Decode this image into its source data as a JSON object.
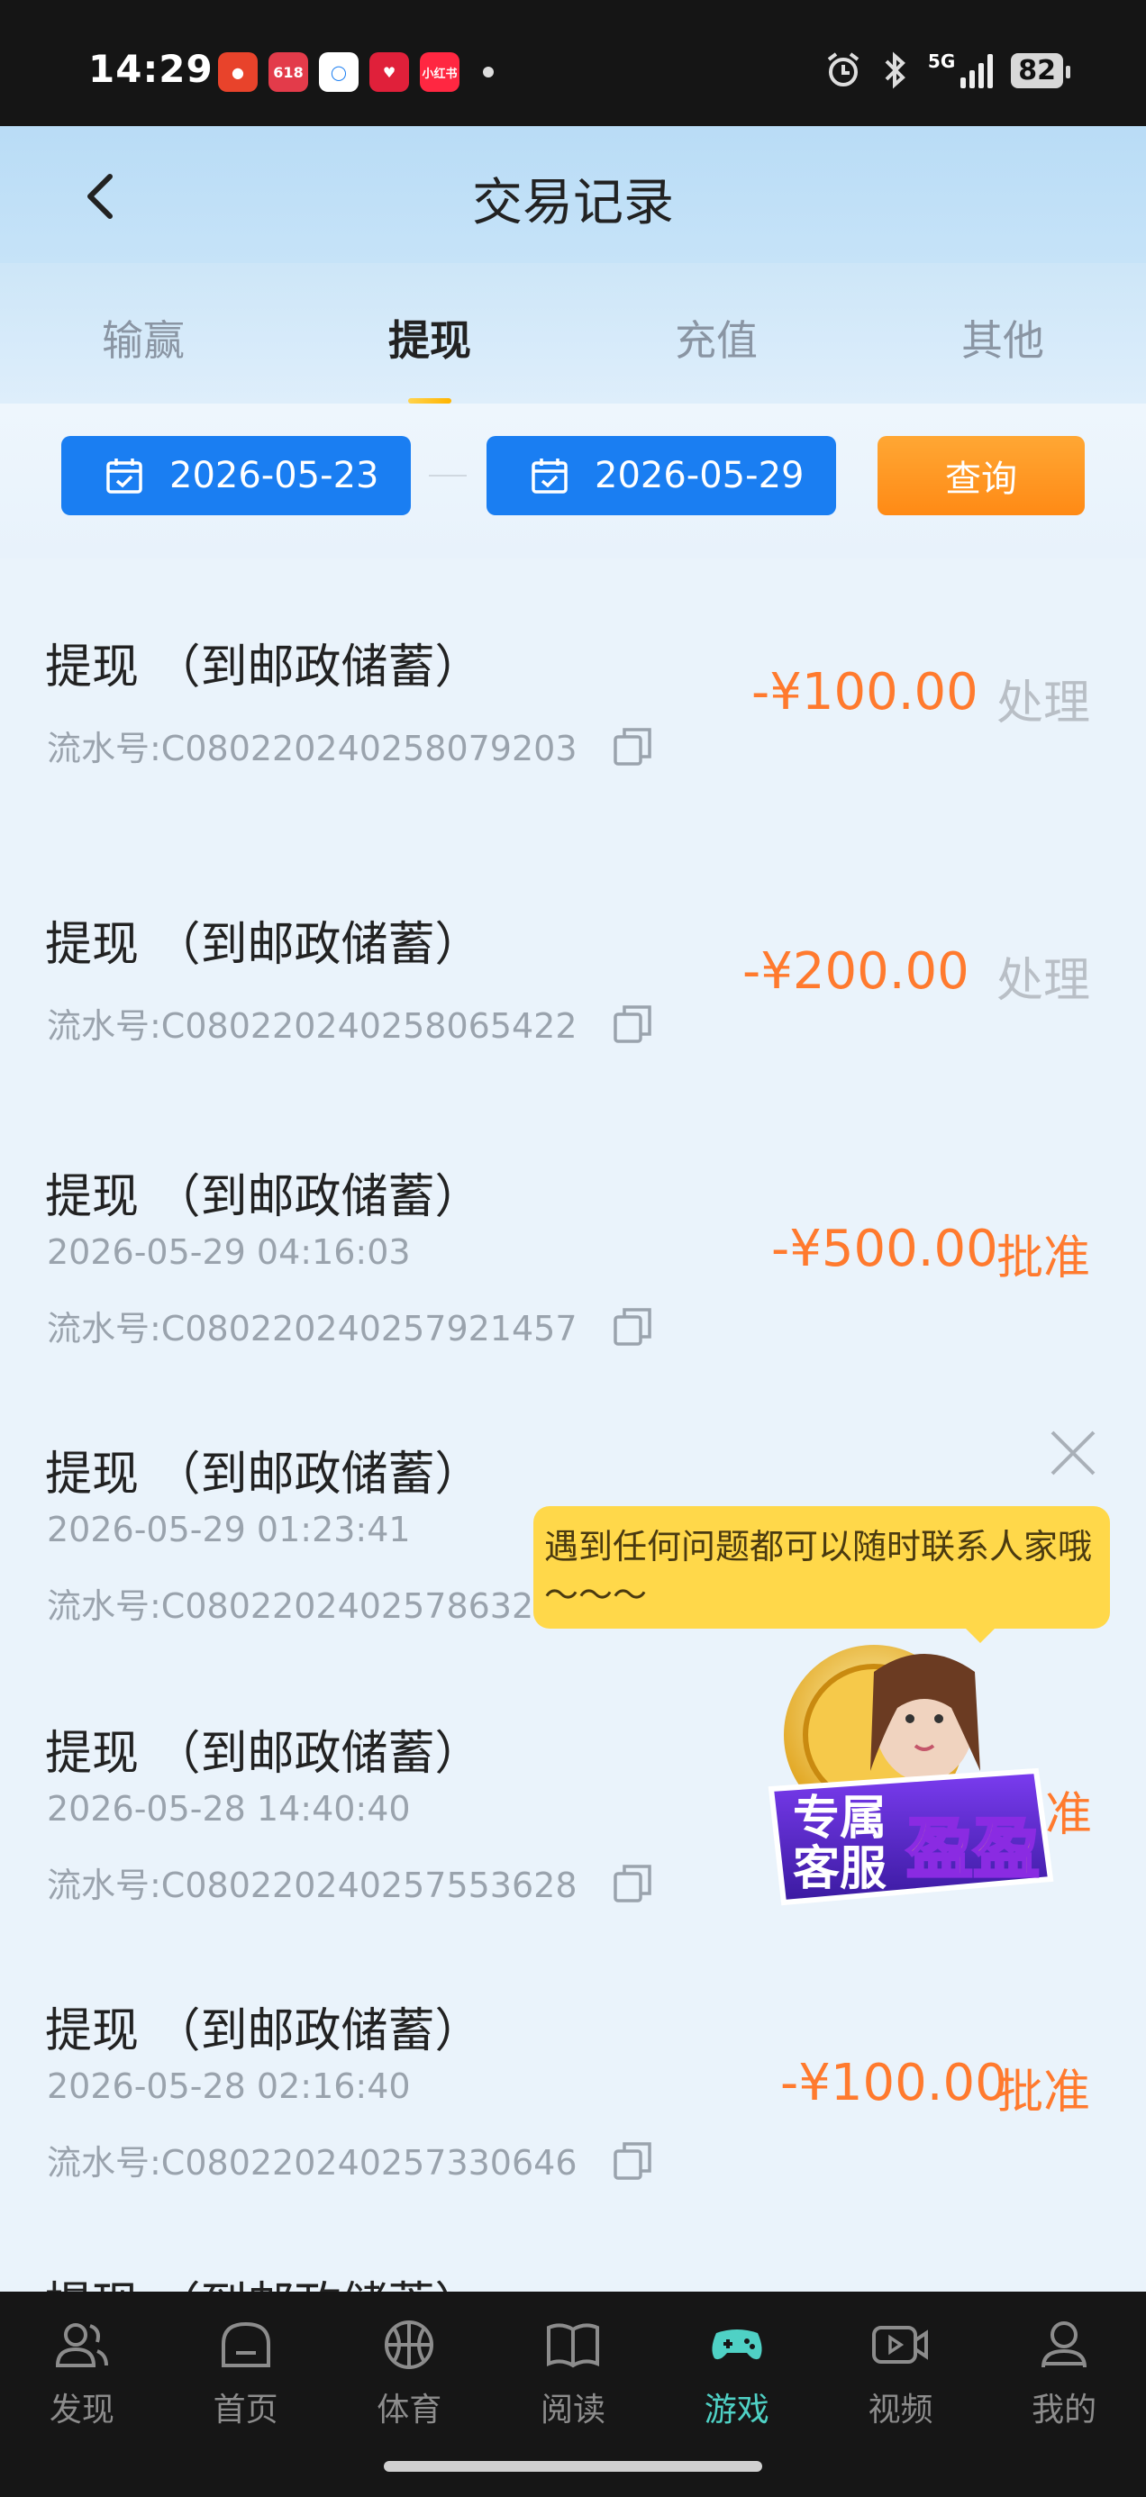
{
  "status_bar": {
    "time": "14:29",
    "battery": "82",
    "network": "5G",
    "icons": [
      "alarm-icon",
      "bluetooth-icon",
      "signal-icon",
      "battery-icon"
    ],
    "app_icons": [
      "app-red-1",
      "app-618",
      "app-blue",
      "app-618-heart",
      "app-xiaohongshu"
    ]
  },
  "header": {
    "title": "交易记录"
  },
  "tabs": [
    {
      "label": "输赢",
      "active": false
    },
    {
      "label": "提现",
      "active": true
    },
    {
      "label": "充值",
      "active": false
    },
    {
      "label": "其他",
      "active": false
    }
  ],
  "filter": {
    "start_date": "2026-05-23",
    "end_date": "2026-05-29",
    "query_label": "查询"
  },
  "records": [
    {
      "title": "提现 （到邮政储蓄）",
      "time": "",
      "serial": "流水号:C08022024025807920​3",
      "amount": "-¥100.00",
      "status": "处理"
    },
    {
      "title": "提现 （到邮政储蓄）",
      "time": "",
      "serial": "流水号:C080220240258065422",
      "amount": "-¥200.00",
      "status": "处理"
    },
    {
      "title": "提现 （到邮政储蓄）",
      "time": "2026-05-29 04:16:03",
      "serial": "流水号:C080220240257921457",
      "amount": "-¥500.00",
      "status": "批准"
    },
    {
      "title": "提现 （到邮政储蓄）",
      "time": "2026-05-29 01:23:41",
      "serial": "流水号:C0802202402578632",
      "amount": "",
      "status": ""
    },
    {
      "title": "提现 （到邮政储蓄）",
      "time": "2026-05-28 14:40:40",
      "serial": "流水号:C080220240257553628",
      "amount": "",
      "status": "准"
    },
    {
      "title": "提现 （到邮政储蓄）",
      "time": "2026-05-28 02:16:40",
      "serial": "流水号:C080220240257330646",
      "amount": "-¥100.00",
      "status": "批准"
    },
    {
      "title": "提现 （到邮政储蓄）",
      "time": "",
      "serial": "",
      "amount": "",
      "status": ""
    }
  ],
  "overlay": {
    "tooltip": "遇到任何问题都可以随时联系人家哦～～～",
    "badge_line1": "专属",
    "badge_line2": "客服",
    "badge_name": "盈盈"
  },
  "bottom_nav": [
    {
      "label": "发现",
      "icon": "users-icon",
      "active": false
    },
    {
      "label": "首页",
      "icon": "home-icon",
      "active": false
    },
    {
      "label": "体育",
      "icon": "basketball-icon",
      "active": false
    },
    {
      "label": "阅读",
      "icon": "book-icon",
      "active": false
    },
    {
      "label": "游戏",
      "icon": "gamepad-icon",
      "active": true
    },
    {
      "label": "视频",
      "icon": "video-icon",
      "active": false
    },
    {
      "label": "我的",
      "icon": "user-icon",
      "active": false
    }
  ],
  "colors": {
    "accent_blue": "#1a7ef2",
    "accent_orange": "#ff8a15",
    "amount_orange": "#ff7a2e",
    "active_nav": "#4fd1c5"
  }
}
